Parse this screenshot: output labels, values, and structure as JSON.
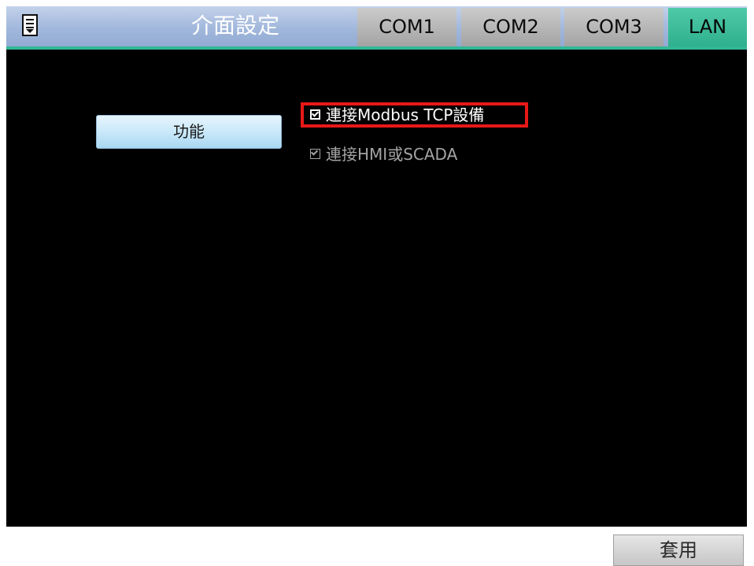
{
  "header": {
    "menu_icon": "menu-list-icon",
    "title": "介面設定",
    "tabs": [
      {
        "label": "COM1",
        "active": false
      },
      {
        "label": "COM2",
        "active": false
      },
      {
        "label": "COM3",
        "active": false
      },
      {
        "label": "LAN",
        "active": true
      }
    ],
    "accent_color": "#32b796"
  },
  "main": {
    "function_button_label": "功能",
    "options": [
      {
        "label": "連接Modbus TCP設備",
        "checked": true,
        "highlighted": true,
        "highlight_color": "#e81818"
      },
      {
        "label": "連接HMI或SCADA",
        "checked": true,
        "highlighted": false,
        "disabled_look": true
      }
    ]
  },
  "footer": {
    "apply_label": "套用"
  }
}
